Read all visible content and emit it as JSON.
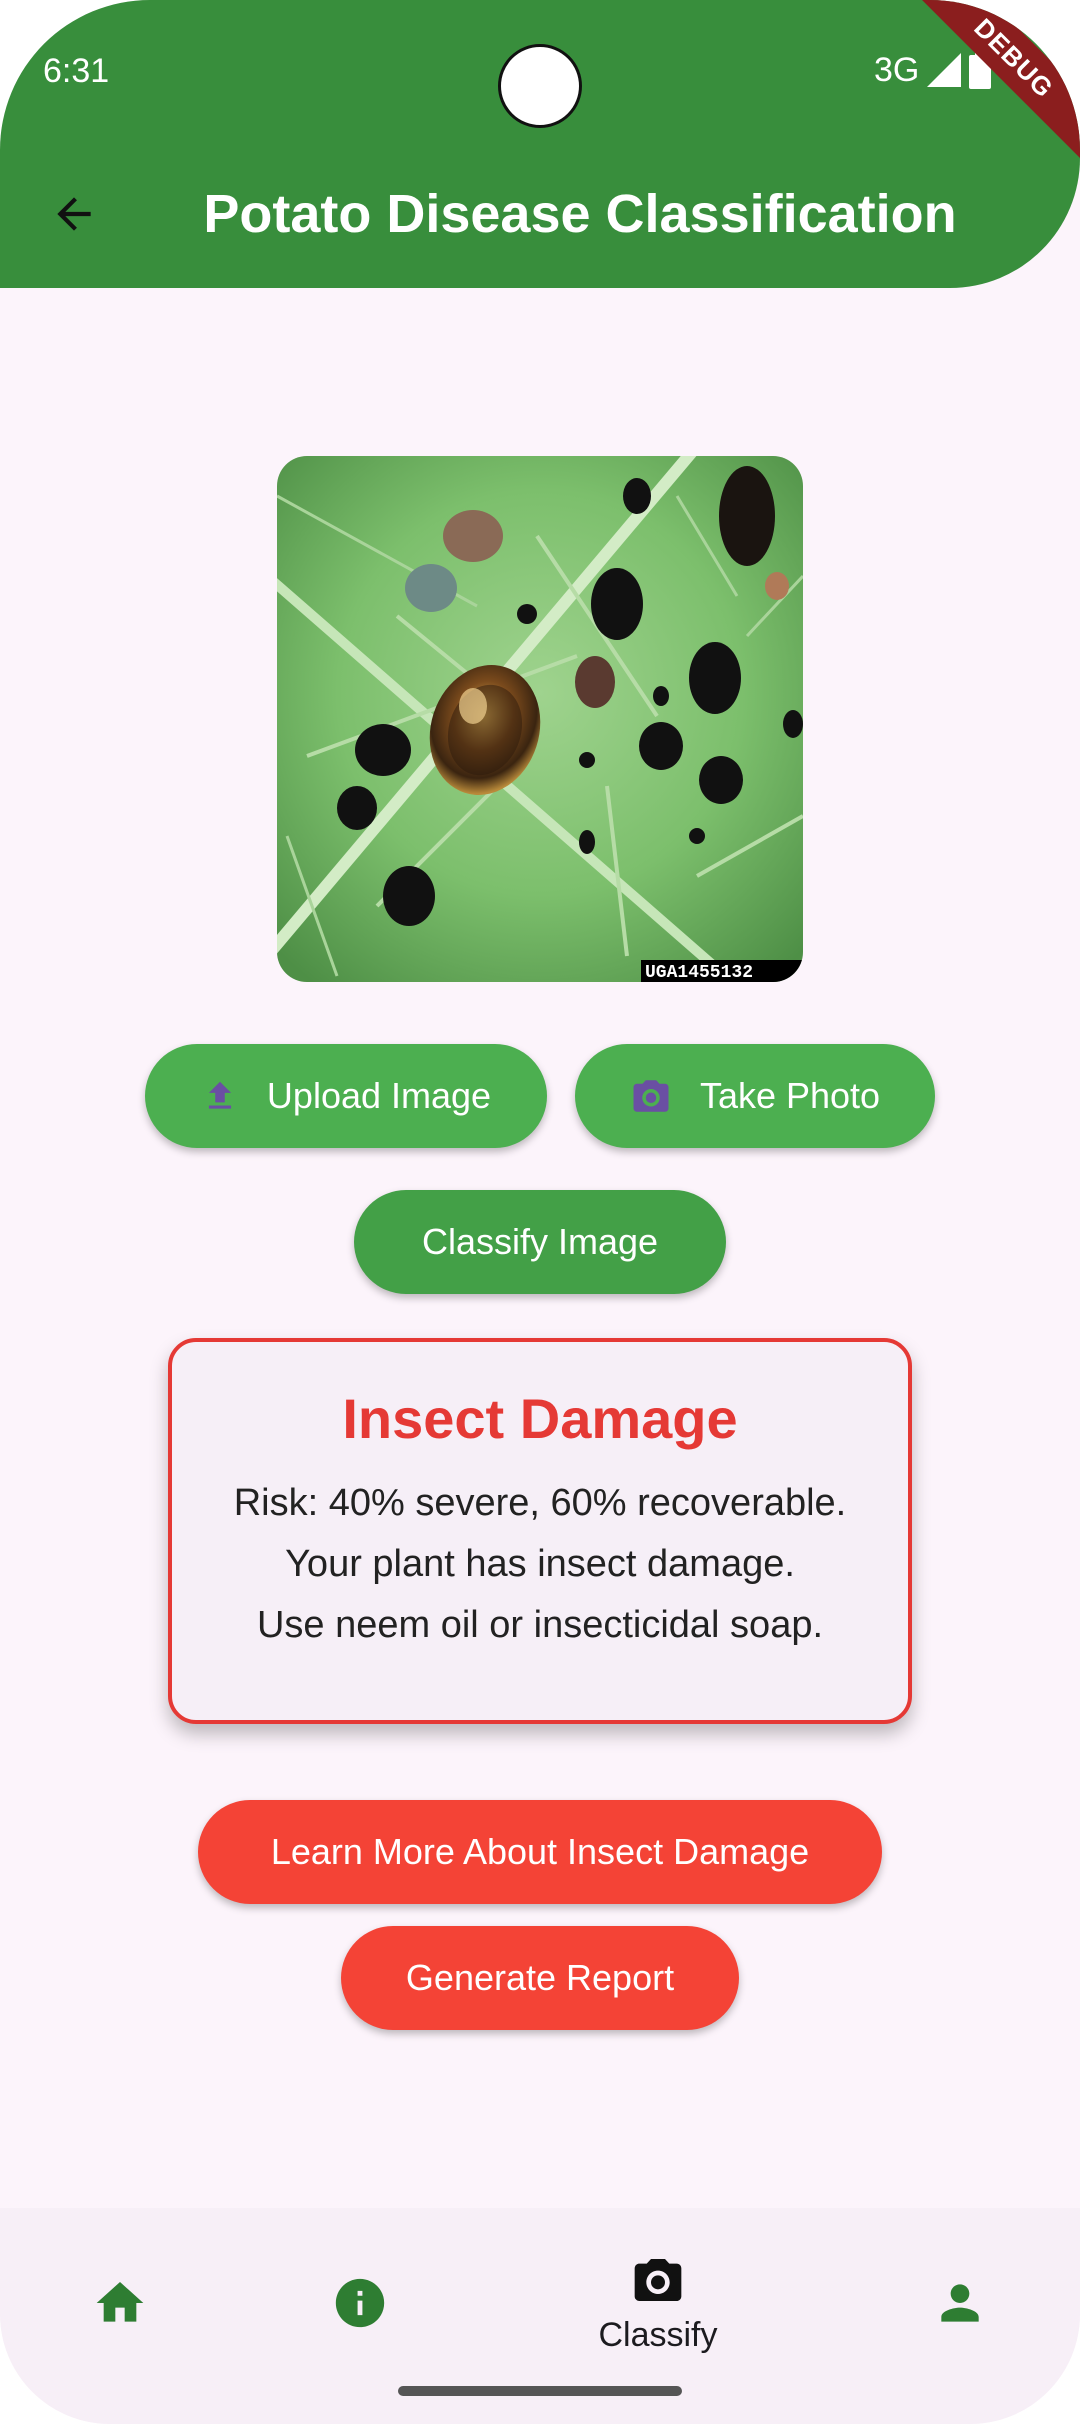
{
  "status_bar": {
    "time": "6:31",
    "network": "3G",
    "debug_banner": "DEBUG"
  },
  "app_bar": {
    "title": "Potato Disease Classification",
    "back_icon": "arrow-back-icon"
  },
  "image": {
    "description_icon": "leaf-photo",
    "watermark": "UGA1455132"
  },
  "buttons": {
    "upload": "Upload Image",
    "take_photo": "Take Photo",
    "classify": "Classify Image",
    "learn_more": "Learn More About Insect Damage",
    "report": "Generate Report"
  },
  "result": {
    "title": "Insect Damage",
    "line1": "Risk: 40% severe, 60% recoverable.",
    "line2": "Your plant has insect damage.",
    "line3": "Use neem oil or insecticidal soap."
  },
  "bottom_nav": {
    "items": [
      {
        "icon": "home-icon"
      },
      {
        "icon": "info-icon"
      },
      {
        "icon": "camera-icon",
        "label": "Classify",
        "selected": true
      },
      {
        "icon": "person-icon"
      }
    ]
  },
  "colors": {
    "appbar": "#388e3c",
    "primary_button": "#4caf50",
    "danger": "#f44336",
    "result_title": "#e53935",
    "background": "#fcf4fb"
  }
}
